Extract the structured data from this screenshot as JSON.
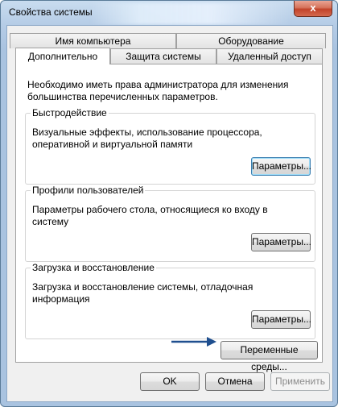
{
  "window": {
    "title": "Свойства системы",
    "close_glyph": "x"
  },
  "tabs": {
    "row_back": [
      {
        "label": "Имя компьютера"
      },
      {
        "label": "Оборудование"
      }
    ],
    "row_front": [
      {
        "label": "Дополнительно",
        "active": true
      },
      {
        "label": "Защита системы"
      },
      {
        "label": "Удаленный доступ"
      }
    ]
  },
  "panel": {
    "note": "Необходимо иметь права администратора для изменения большинства перечисленных параметров.",
    "groups": [
      {
        "legend": "Быстродействие",
        "description": "Визуальные эффекты, использование процессора, оперативной и виртуальной памяти",
        "button": "Параметры...",
        "focused": true
      },
      {
        "legend": "Профили пользователей",
        "description": "Параметры рабочего стола, относящиеся ко входу в систему",
        "button": "Параметры..."
      },
      {
        "legend": "Загрузка и восстановление",
        "description": "Загрузка и восстановление системы, отладочная информация",
        "button": "Параметры..."
      }
    ],
    "env_button": "Переменные среды..."
  },
  "annotation": {
    "icon": "arrow-right-icon",
    "color": "#1f4f8f"
  },
  "footer": {
    "ok": "OK",
    "cancel": "Отмена",
    "apply": "Применить",
    "apply_enabled": false
  }
}
